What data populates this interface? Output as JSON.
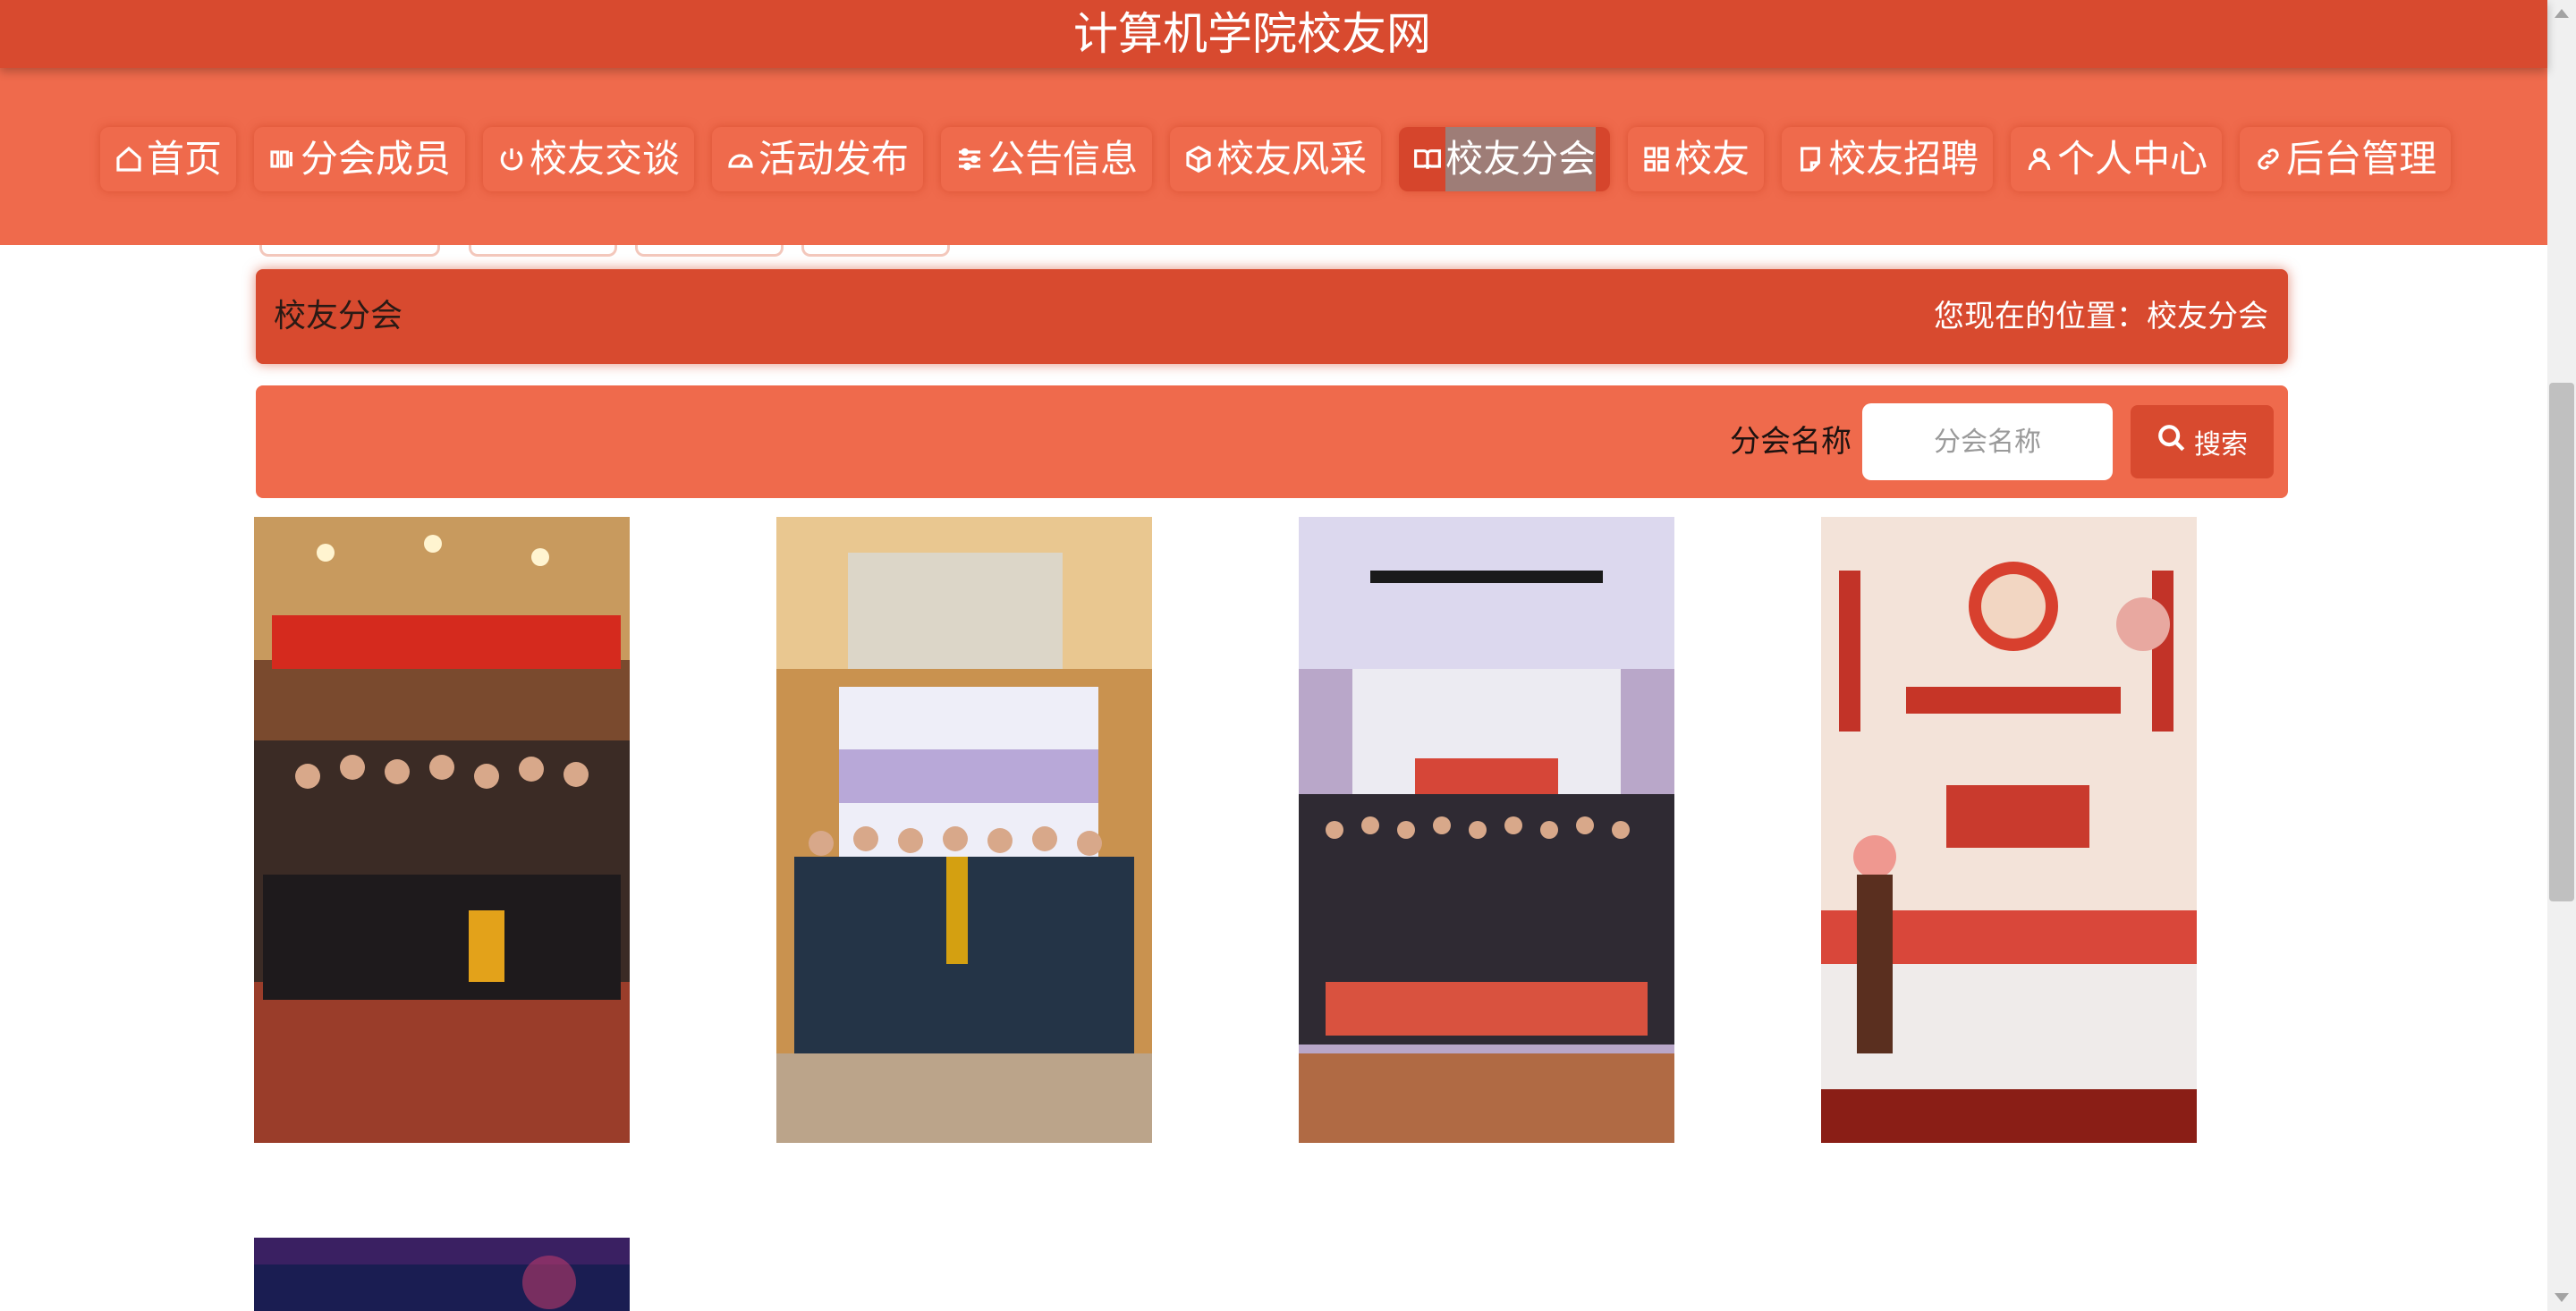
{
  "site": {
    "title": "计算机学院校友网"
  },
  "nav": {
    "items": [
      {
        "label": "首页",
        "icon": "home-icon"
      },
      {
        "label": "分会成员",
        "icon": "members-icon"
      },
      {
        "label": "校友交谈",
        "icon": "power-icon"
      },
      {
        "label": "活动发布",
        "icon": "gauge-icon"
      },
      {
        "label": "公告信息",
        "icon": "sliders-icon"
      },
      {
        "label": "校友风采",
        "icon": "cube-icon"
      },
      {
        "label": "校友分会",
        "icon": "book-open-icon",
        "active": true
      },
      {
        "label": "校友",
        "icon": "grid-icon"
      },
      {
        "label": "校友招聘",
        "icon": "document-icon"
      },
      {
        "label": "个人中心",
        "icon": "user-icon"
      },
      {
        "label": "后台管理",
        "icon": "link-icon"
      }
    ]
  },
  "page": {
    "title": "校友分会",
    "breadcrumb": "您现在的位置：校友分会"
  },
  "search": {
    "label": "分会名称",
    "placeholder": "分会名称",
    "value": "",
    "button_label": "搜索"
  },
  "branches": [
    {
      "photo": "group-photo-1"
    },
    {
      "photo": "group-photo-2"
    },
    {
      "photo": "group-photo-3"
    },
    {
      "photo": "group-photo-4"
    },
    {
      "photo": "group-photo-5"
    }
  ],
  "colors": {
    "title_bar": "#d84a2f",
    "nav_bar": "#ef6a4c",
    "accent": "#d84a2f"
  }
}
